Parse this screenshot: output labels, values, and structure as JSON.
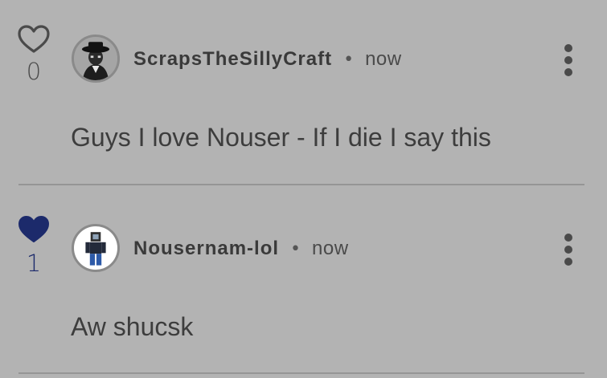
{
  "comments": [
    {
      "like_count": "0",
      "liked": false,
      "username": "ScrapsTheSillyCraft",
      "separator": "•",
      "timestamp": "now",
      "text": "Guys I love Nouser - If I die I say this"
    },
    {
      "like_count": "1",
      "liked": true,
      "username": "Nousernam-lol",
      "separator": "•",
      "timestamp": "now",
      "text": "Aw shucsk"
    }
  ],
  "icons": {
    "like_unfilled": "heart-outline-icon",
    "like_filled": "heart-filled-icon",
    "more": "kebab-menu-icon"
  },
  "colors": {
    "background": "#b3b3b3",
    "liked_heart": "#1c2a6b",
    "text": "#3d3d3d",
    "divider": "#959595"
  }
}
